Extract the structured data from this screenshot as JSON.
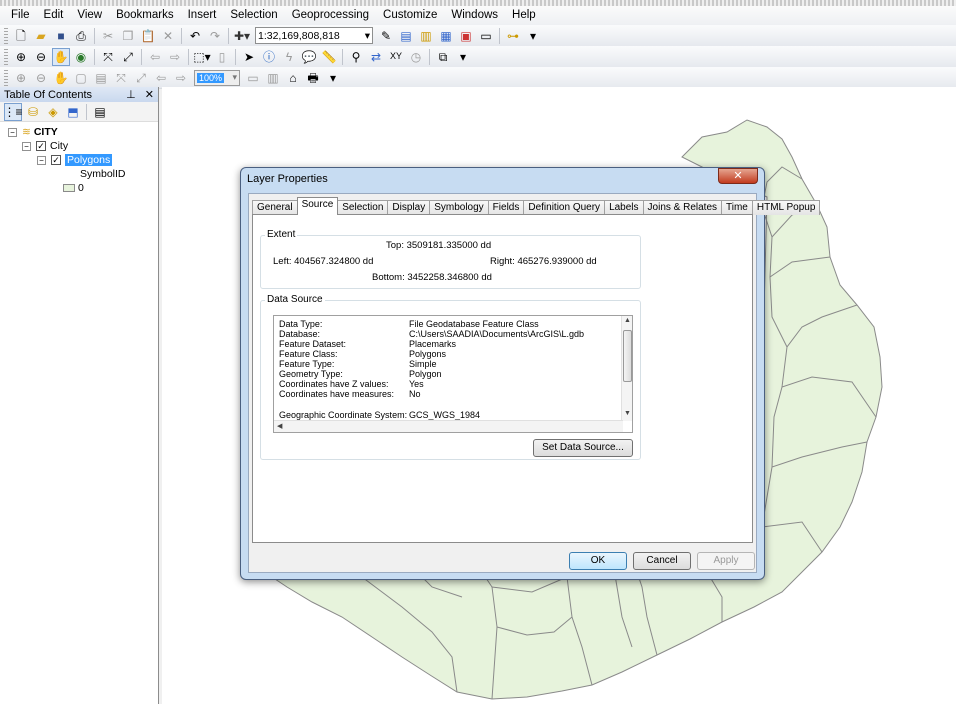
{
  "menu": [
    "File",
    "Edit",
    "View",
    "Bookmarks",
    "Insert",
    "Selection",
    "Geoprocessing",
    "Customize",
    "Windows",
    "Help"
  ],
  "toolbar": {
    "scale_value": "1:32,169,808,818",
    "zoom_combo_value": "100%"
  },
  "toc": {
    "title": "Table Of Contents",
    "pin_glyph": "⊥",
    "close_glyph": "✕",
    "tree": {
      "dataframe": "CITY",
      "group_layer": "City",
      "layer": "Polygons",
      "field": "SymbolID",
      "value": "0"
    }
  },
  "dialog": {
    "title": "Layer Properties",
    "close_glyph": "✕",
    "tabs": [
      "General",
      "Source",
      "Selection",
      "Display",
      "Symbology",
      "Fields",
      "Definition Query",
      "Labels",
      "Joins & Relates",
      "Time",
      "HTML Popup"
    ],
    "active_tab": "Source",
    "extent": {
      "label": "Extent",
      "top": "Top:  3509181.335000 dd",
      "left": "Left:  404567.324800 dd",
      "right": "Right:  465276.939000 dd",
      "bottom": "Bottom:  3452258.346800 dd"
    },
    "data_source": {
      "label": "Data Source",
      "rows": [
        {
          "key": "Data Type:",
          "value": "File Geodatabase Feature Class"
        },
        {
          "key": "Database:",
          "value": "C:\\Users\\SAADIA\\Documents\\ArcGIS\\L.gdb"
        },
        {
          "key": "Feature Dataset:",
          "value": "Placemarks"
        },
        {
          "key": "Feature Class:",
          "value": "Polygons"
        },
        {
          "key": "Feature Type:",
          "value": "Simple"
        },
        {
          "key": "Geometry Type:",
          "value": "Polygon"
        },
        {
          "key": "Coordinates have Z values:",
          "value": "Yes"
        },
        {
          "key": "Coordinates have measures:",
          "value": "No"
        },
        {
          "key": "",
          "value": ""
        },
        {
          "key": "Geographic Coordinate System:",
          "value": "GCS_WGS_1984"
        }
      ],
      "set_button": "Set Data Source..."
    },
    "buttons": {
      "ok": "OK",
      "cancel": "Cancel",
      "apply": "Apply"
    }
  },
  "colors": {
    "map_fill": "#e7f3dc",
    "map_stroke": "#8a8a8a",
    "selection": "#3399ff"
  }
}
